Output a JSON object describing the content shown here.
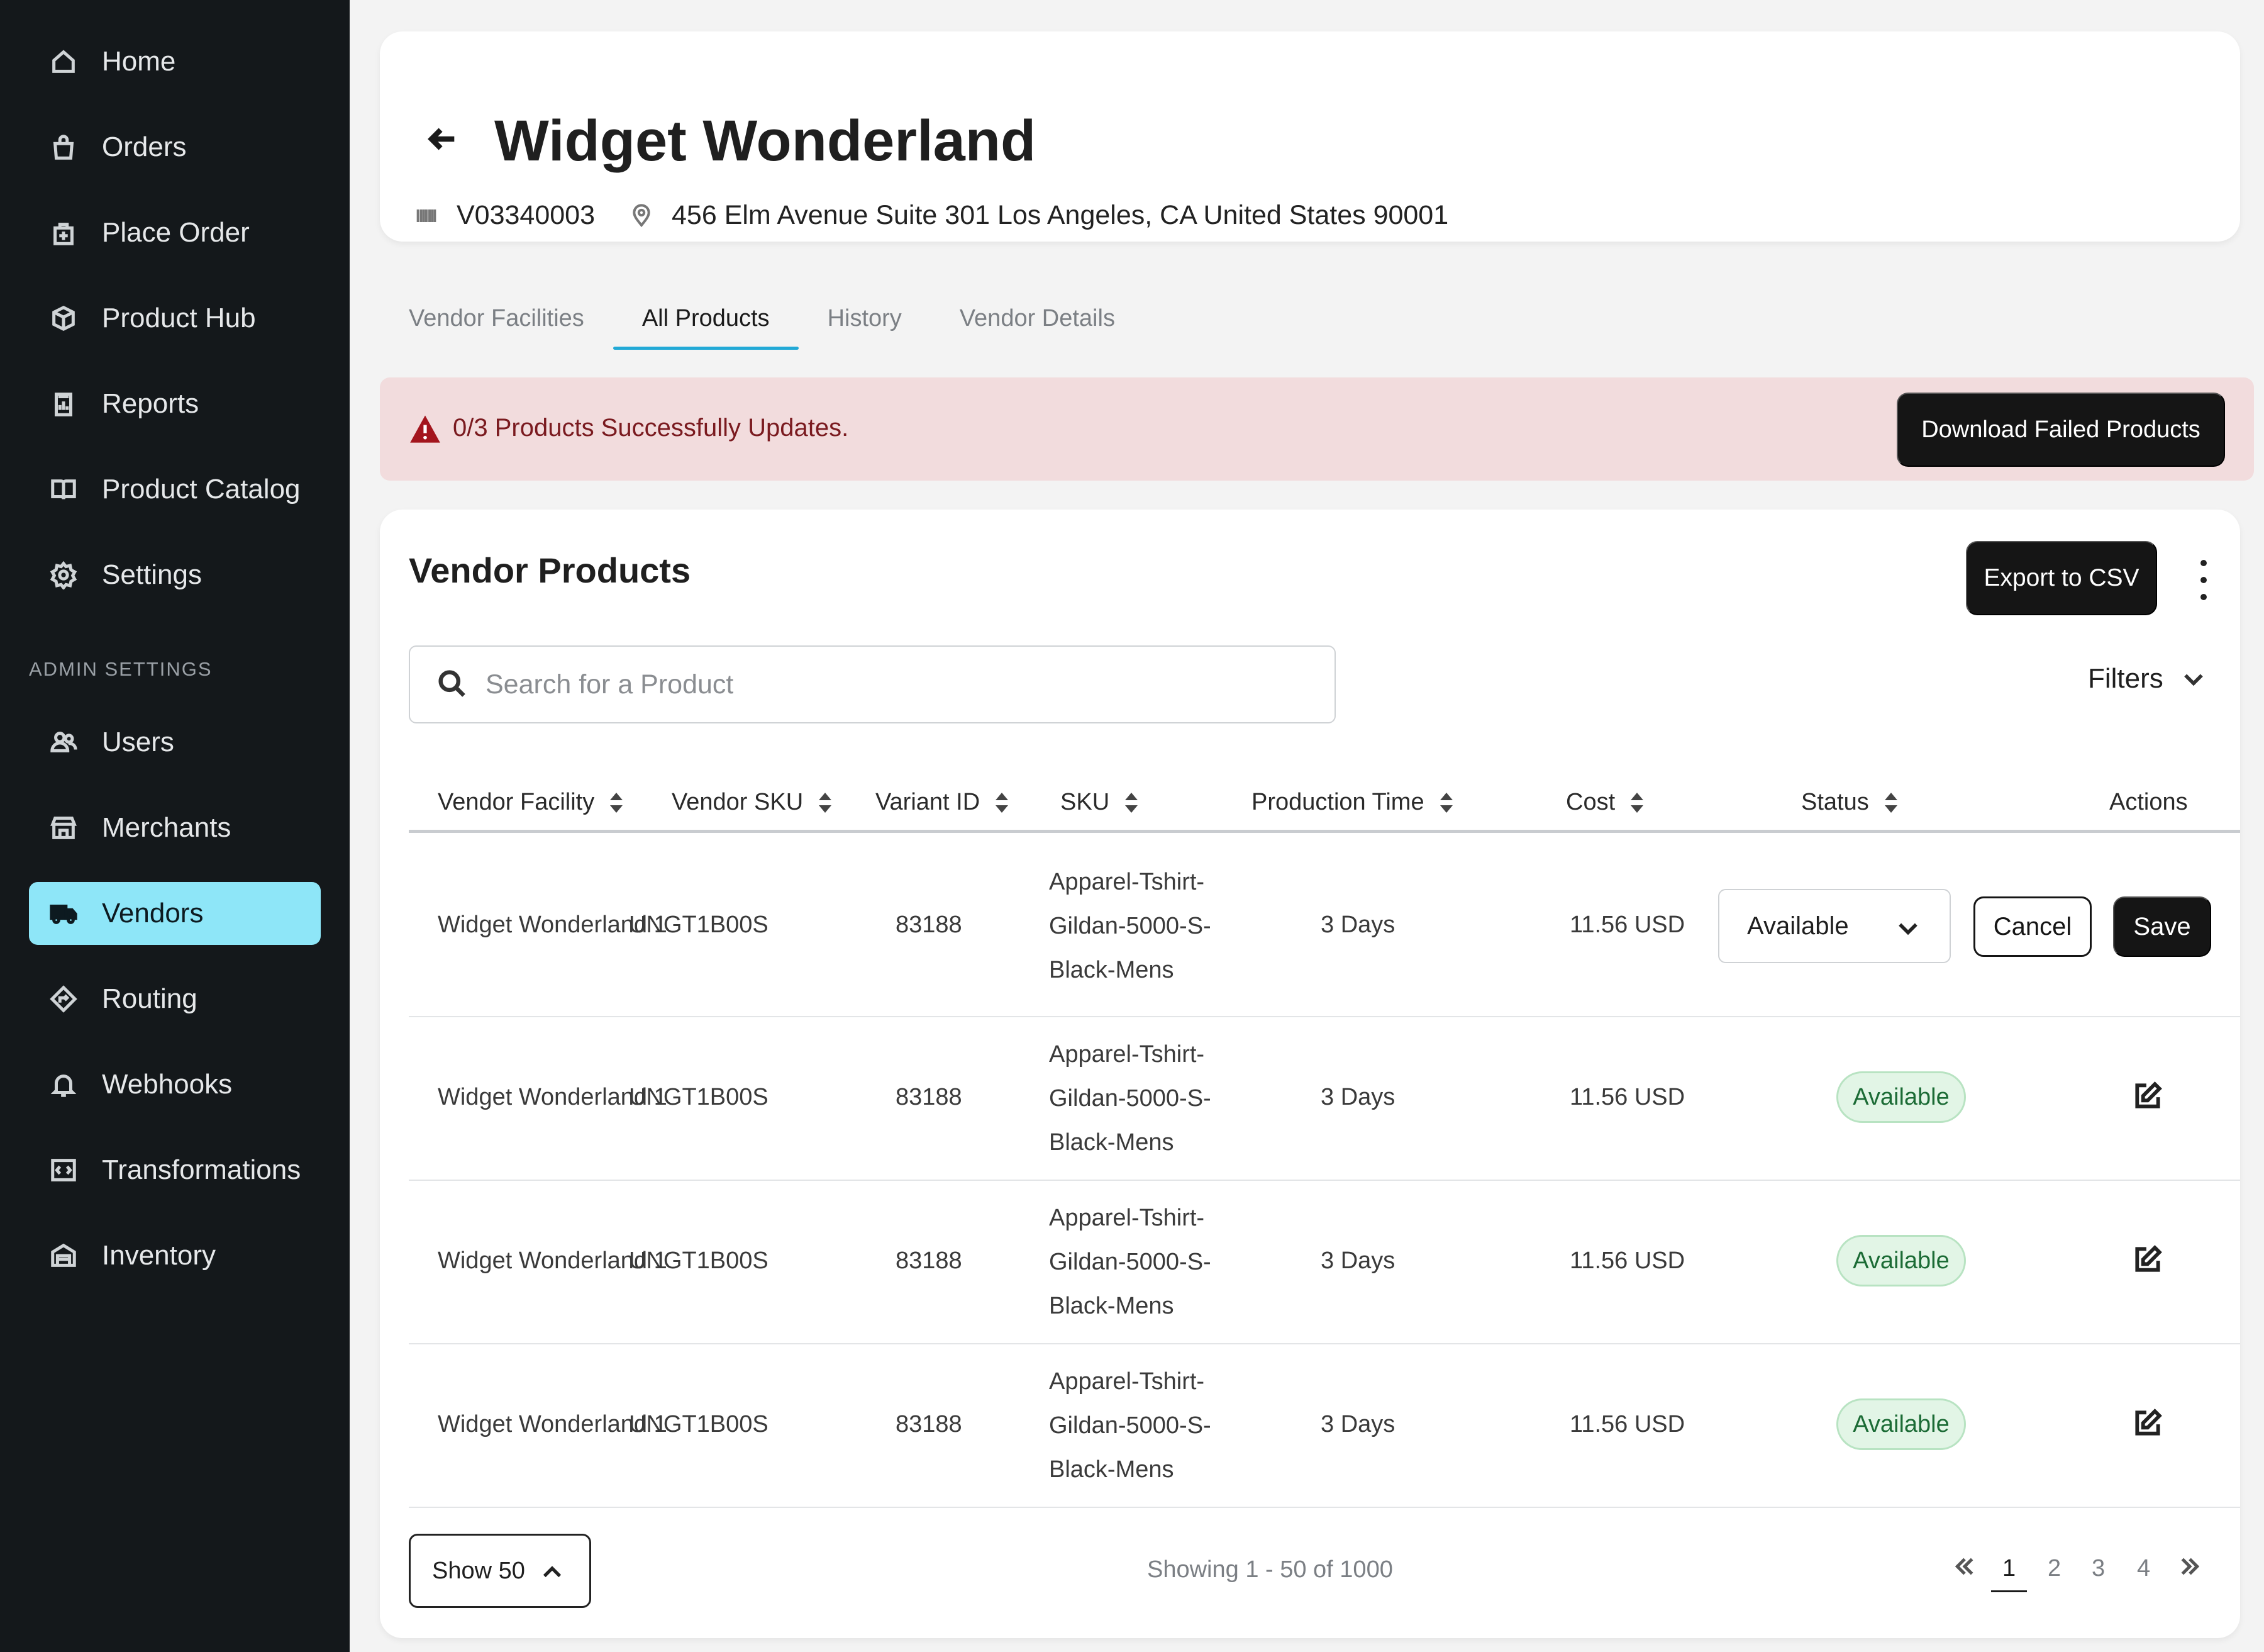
{
  "sidebar": {
    "items": [
      {
        "label": "Home",
        "icon": "home-icon"
      },
      {
        "label": "Orders",
        "icon": "shopping-bag-icon"
      },
      {
        "label": "Place Order",
        "icon": "add-bag-icon"
      },
      {
        "label": "Product Hub",
        "icon": "box-icon"
      },
      {
        "label": "Reports",
        "icon": "clipboard-chart-icon"
      },
      {
        "label": "Product Catalog",
        "icon": "book-icon"
      },
      {
        "label": "Settings",
        "icon": "gear-icon"
      }
    ],
    "section_label": "ADMIN SETTINGS",
    "admin_items": [
      {
        "label": "Users",
        "icon": "users-icon"
      },
      {
        "label": "Merchants",
        "icon": "store-icon"
      },
      {
        "label": "Vendors",
        "icon": "truck-icon",
        "active": true
      },
      {
        "label": "Routing",
        "icon": "route-sign-icon"
      },
      {
        "label": "Webhooks",
        "icon": "bell-icon"
      },
      {
        "label": "Transformations",
        "icon": "code-icon"
      },
      {
        "label": "Inventory",
        "icon": "warehouse-icon"
      }
    ]
  },
  "header": {
    "title": "Widget Wonderland",
    "vendor_id": "V03340003",
    "address": "456 Elm Avenue Suite 301 Los Angeles, CA United States 90001"
  },
  "tabs": [
    {
      "label": "Vendor Facilities"
    },
    {
      "label": "All Products",
      "active": true
    },
    {
      "label": "History"
    },
    {
      "label": "Vendor Details"
    }
  ],
  "alert": {
    "message": "0/3 Products Successfully Updates.",
    "button_label": "Download Failed Products"
  },
  "products": {
    "title": "Vendor Products",
    "export_label": "Export to CSV",
    "search_placeholder": "Search for a Product",
    "filters_label": "Filters",
    "columns": [
      "Vendor Facility",
      "Vendor SKU",
      "Variant ID",
      "SKU",
      "Production Time",
      "Cost",
      "Status",
      "Actions"
    ],
    "rows": [
      {
        "facility": "Widget Wonderland 1",
        "vendor_sku": "UNGT1B00S",
        "variant_id": "83188",
        "sku_lines": [
          "Apparel-Tshirt-",
          "Gildan-5000-S-",
          "Black-Mens"
        ],
        "production_time": "3 Days",
        "cost": "11.56 USD",
        "status": "Available",
        "editing": true
      },
      {
        "facility": "Widget Wonderland 1",
        "vendor_sku": "UNGT1B00S",
        "variant_id": "83188",
        "sku_lines": [
          "Apparel-Tshirt-",
          "Gildan-5000-S-",
          "Black-Mens"
        ],
        "production_time": "3 Days",
        "cost": "11.56 USD",
        "status": "Available"
      },
      {
        "facility": "Widget Wonderland 1",
        "vendor_sku": "UNGT1B00S",
        "variant_id": "83188",
        "sku_lines": [
          "Apparel-Tshirt-",
          "Gildan-5000-S-",
          "Black-Mens"
        ],
        "production_time": "3 Days",
        "cost": "11.56 USD",
        "status": "Available"
      },
      {
        "facility": "Widget Wonderland 1",
        "vendor_sku": "UNGT1B00S",
        "variant_id": "83188",
        "sku_lines": [
          "Apparel-Tshirt-",
          "Gildan-5000-S-",
          "Black-Mens"
        ],
        "production_time": "3 Days",
        "cost": "11.56 USD",
        "status": "Available"
      }
    ],
    "cancel_label": "Cancel",
    "save_label": "Save"
  },
  "footer": {
    "page_size_label": "Show 50",
    "showing_text": "Showing 1 - 50 of 1000",
    "pages": [
      "1",
      "2",
      "3",
      "4"
    ],
    "current_page": "1"
  },
  "colors": {
    "sidebar_bg": "#14181b",
    "active_nav": "#8ee6f8",
    "tab_accent": "#22a9d6",
    "alert_bg": "#f2dcdd",
    "alert_text": "#7a1a1f",
    "badge_bg": "#e2f5e6",
    "badge_text": "#1b6b35"
  }
}
